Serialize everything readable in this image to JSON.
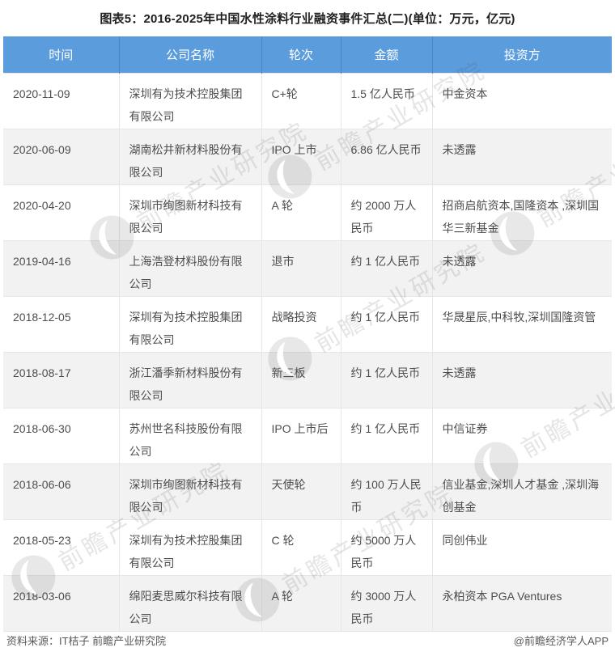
{
  "chart_data": {
    "type": "table",
    "title": "图表5：2016-2025年中国水性涂料行业融资事件汇总(二)(单位：万元，亿元)",
    "columns": [
      "时间",
      "公司名称",
      "轮次",
      "金额",
      "投资方"
    ],
    "rows": [
      [
        "2020-11-09",
        "深圳有为技术控股集团有限公司",
        "C+轮",
        "1.5 亿人民币",
        "中金资本"
      ],
      [
        "2020-06-09",
        "湖南松井新材料股份有限公司",
        "IPO 上市",
        "6.86 亿人民币",
        "未透露"
      ],
      [
        "2020-04-20",
        "深圳市绚图新材科技有限公司",
        "A 轮",
        "约 2000 万人民币",
        "招商启航资本,国隆资本 ,深圳国华三新基金"
      ],
      [
        "2019-04-16",
        "上海浩登材料股份有限公司",
        "退市",
        "约 1 亿人民币",
        "未透露"
      ],
      [
        "2018-12-05",
        "深圳有为技术控股集团有限公司",
        "战略投资",
        "约 1 亿人民币",
        "华晟星辰,中科牧,深圳国隆资管"
      ],
      [
        "2018-08-17",
        "浙江潘季新材料股份有限公司",
        "新三板",
        "约 1 亿人民币",
        "未透露"
      ],
      [
        "2018-06-30",
        "苏州世名科技股份有限公司",
        "IPO 上市后",
        "约 1 亿人民币",
        "中信证券"
      ],
      [
        "2018-06-06",
        "深圳市绚图新材科技有限公司",
        "天使轮",
        "约 100 万人民币",
        "信业基金,深圳人才基金 ,深圳海创基金"
      ],
      [
        "2018-05-23",
        "深圳有为技术控股集团有限公司",
        "C 轮",
        "约 5000 万人民币",
        "同创伟业"
      ],
      [
        "2018-03-06",
        "绵阳麦思威尔科技有限公司",
        "A 轮",
        "约 3000 万人民币",
        "永柏资本 PGA Ventures"
      ]
    ],
    "layout_hints": {
      "header_style": "blue banded header",
      "zebra_rows": true,
      "grid": true
    }
  },
  "footer": {
    "source": "资料来源：IT桔子 前瞻产业研究院",
    "credit": "@前瞻经济学人APP"
  },
  "watermark": {
    "text": "前瞻产业研究院",
    "logo": "qianzhan-logo"
  },
  "colors": {
    "header_bg": "#5B9CDD",
    "header_text": "#FFFFFF",
    "row_alt_bg": "#F2F2F2",
    "body_text": "#4D4D4D",
    "border": "#E6E6E6",
    "title_text": "#1F1F1F",
    "footer_text": "#595959"
  }
}
